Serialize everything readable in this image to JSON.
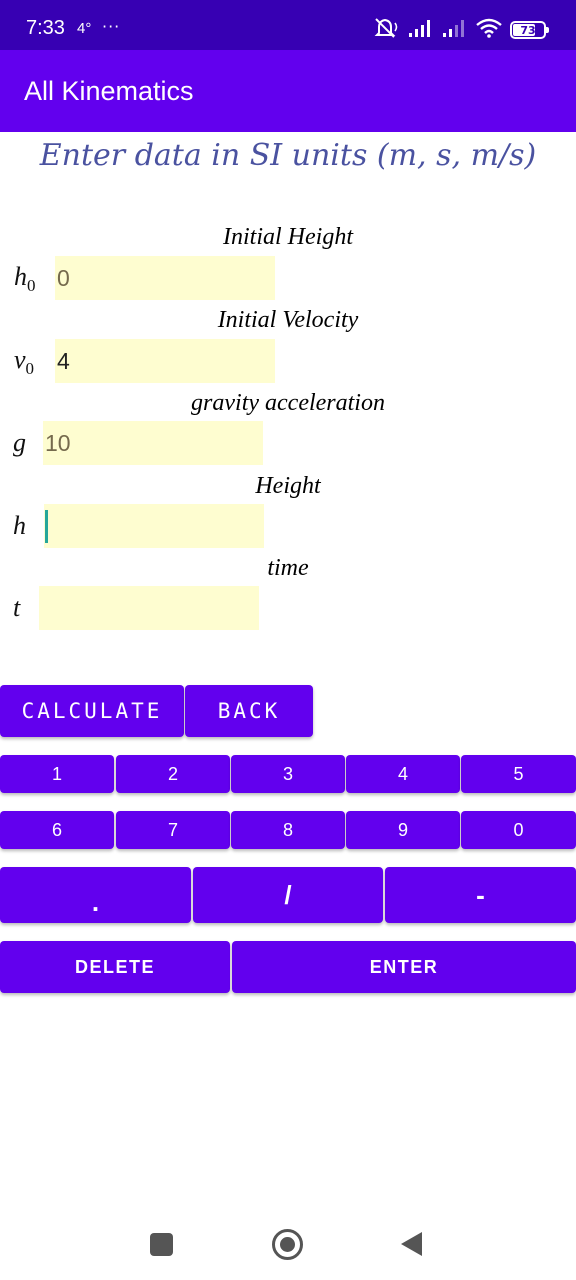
{
  "status_bar": {
    "time": "7:33",
    "temperature": "4°",
    "more": "···",
    "battery_level": "73",
    "battery_fraction": 0.73
  },
  "app_bar": {
    "title": "All Kinematics"
  },
  "instruction": "Enter data in SI units (m, s, m/s)",
  "fields": [
    {
      "label": "Initial Height",
      "symbol": "h",
      "subscript": "0",
      "value": "0"
    },
    {
      "label": "Initial Velocity",
      "symbol": "v",
      "subscript": "0",
      "value": "4"
    },
    {
      "label": "gravity acceleration",
      "symbol": "g",
      "subscript": "",
      "value": "10"
    },
    {
      "label": "Height",
      "symbol": "h",
      "subscript": "",
      "value": ""
    },
    {
      "label": "time",
      "symbol": "t",
      "subscript": "",
      "value": ""
    }
  ],
  "actions": {
    "calculate": "CALCULATE",
    "back": "BACK"
  },
  "keypad": {
    "row1": [
      "1",
      "2",
      "3",
      "4",
      "5"
    ],
    "row2": [
      "6",
      "7",
      "8",
      "9",
      "0"
    ],
    "row3": [
      ".",
      "/",
      "-"
    ],
    "delete": "DELETE",
    "enter": "ENTER"
  },
  "colors": {
    "status_bar": "#3700b3",
    "primary": "#6200ee",
    "input_background": "#fefdd0",
    "instruction_text": "#4a52a0",
    "cursor": "#26a69a"
  },
  "icons": {
    "status_bar": [
      "mute-icon",
      "signal-icon",
      "signal-icon",
      "wifi-icon",
      "battery-icon"
    ],
    "nav": [
      "recent-apps-icon",
      "home-icon",
      "back-icon"
    ]
  }
}
